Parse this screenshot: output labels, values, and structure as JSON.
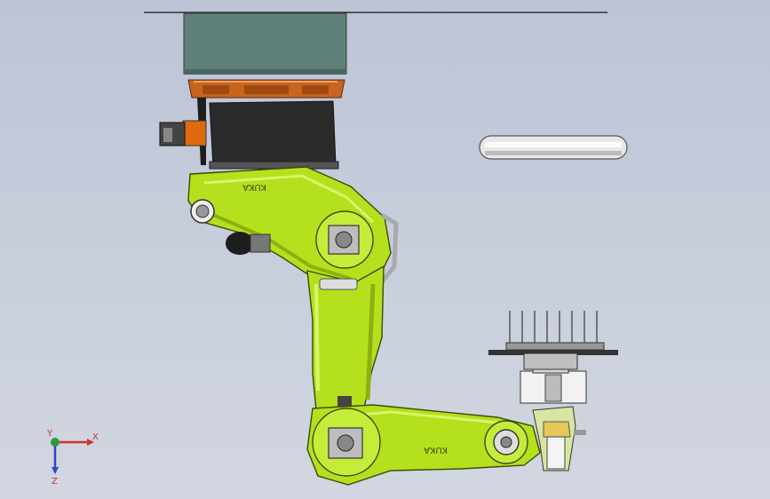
{
  "model": {
    "brand_label": "KUKA",
    "colors": {
      "background_top": "#bcc4d6",
      "background_bottom": "#d2d6e0",
      "arm_green": "#b5e01e",
      "arm_shadow": "#8db010",
      "mount_plate": "#5e8078",
      "base_orange": "#c8641e",
      "base_black": "#2b2b2b"
    }
  },
  "triad": {
    "x_label": "X",
    "y_label": "Y",
    "z_label": "Z",
    "x_color": "#d0342c",
    "y_color": "#2e9a3a",
    "z_color": "#2d44c8"
  }
}
